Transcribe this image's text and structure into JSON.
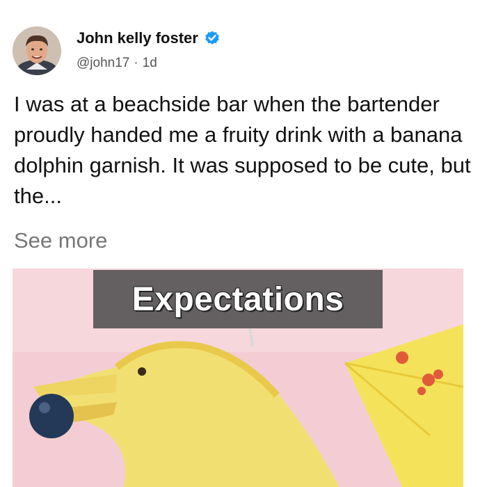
{
  "tweet": {
    "author_name": "John kelly foster",
    "handle": "@john17",
    "separator": "·",
    "time_ago": "1d",
    "text": "I was at a beachside bar when the bartender proudly handed me a fruity drink with a banana dolphin garnish. It was supposed to be cute, but the...",
    "see_more": "See more",
    "verified_color": "#1d9bf0"
  },
  "media": {
    "caption": "Expectations",
    "icon": "banana-dolphin-image"
  }
}
